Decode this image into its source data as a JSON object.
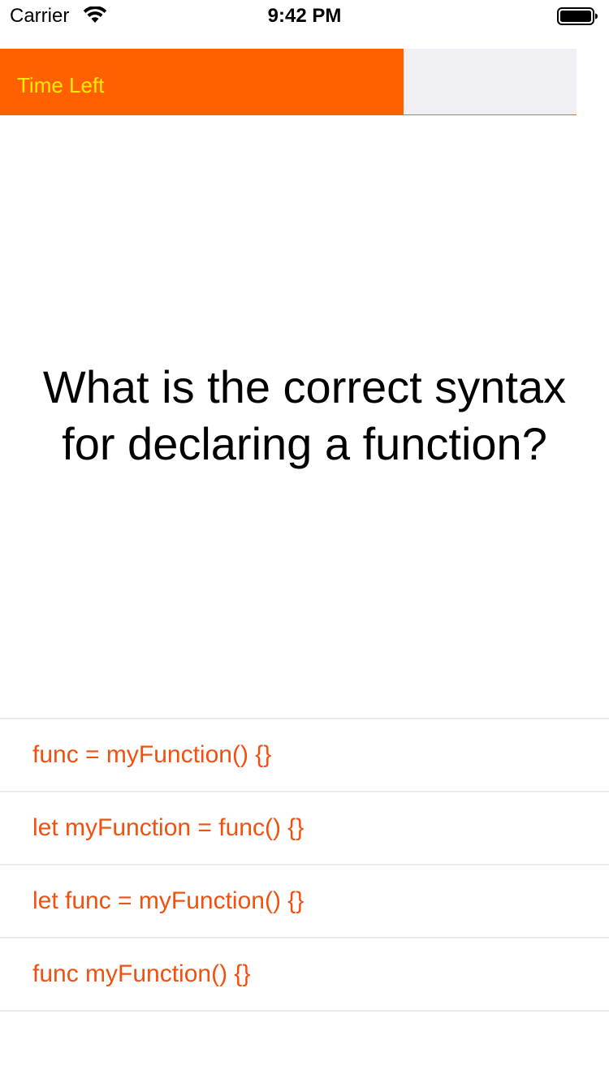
{
  "status_bar": {
    "carrier": "Carrier",
    "time": "9:42 PM",
    "wifi_icon": "wifi-icon",
    "battery_icon": "battery-icon"
  },
  "timer": {
    "label": "Time Left",
    "progress": 0.7,
    "fill_color": "#ff6100",
    "track_color": "#efeff4",
    "label_color": "#ffea00"
  },
  "question": {
    "text": "What is the correct syntax for declaring a function?"
  },
  "answers": {
    "color": "#f2500f",
    "items": [
      {
        "label": "func = myFunction() {}"
      },
      {
        "label": "let myFunction = func() {}"
      },
      {
        "label": "let func = myFunction() {}"
      },
      {
        "label": "func myFunction() {}"
      }
    ]
  }
}
